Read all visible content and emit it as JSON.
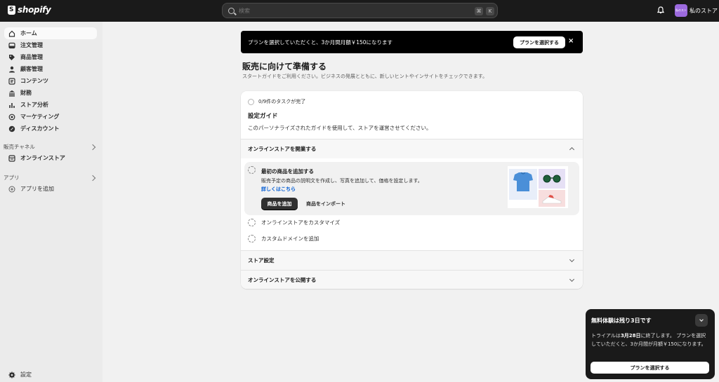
{
  "topbar": {
    "brand": "shopify",
    "search_placeholder": "検索",
    "shortcut_keys": [
      "⌘",
      "K"
    ],
    "store_avatar_text": "私のスト",
    "store_name": "私のストア"
  },
  "sidebar": {
    "items": [
      {
        "label": "ホーム",
        "icon": "home-icon",
        "active": true
      },
      {
        "label": "注文管理",
        "icon": "inbox-icon"
      },
      {
        "label": "商品管理",
        "icon": "tag-icon"
      },
      {
        "label": "顧客管理",
        "icon": "person-icon"
      },
      {
        "label": "コンテンツ",
        "icon": "content-icon"
      },
      {
        "label": "財務",
        "icon": "bank-icon"
      },
      {
        "label": "ストア分析",
        "icon": "bar-chart-icon"
      },
      {
        "label": "マーケティング",
        "icon": "target-icon"
      },
      {
        "label": "ディスカウント",
        "icon": "discount-icon"
      }
    ],
    "sales_channels_label": "販売チャネル",
    "online_store_label": "オンラインストア",
    "apps_label": "アプリ",
    "add_app_label": "アプリを追加",
    "settings_label": "設定"
  },
  "banner": {
    "text": "プランを選択していただくと、3か月間月額￥150になります",
    "button": "プランを選択する",
    "close": "×"
  },
  "main": {
    "title": "販売に向けて準備する",
    "subtitle": "スタートガイドをご利用ください。ビジネスの発展とともに、新しいヒントやインサイトをチェックできます。"
  },
  "setup_guide": {
    "progress": "0/9件のタスクが完了",
    "title": "設定ガイド",
    "description": "このパーソナライズされたガイドを使用して、ストアを運営させてください。",
    "sections": [
      {
        "label": "オンラインストアを開業する",
        "expanded": true
      },
      {
        "label": "ストア設定",
        "expanded": false
      },
      {
        "label": "オンラインストアを公開する",
        "expanded": false
      }
    ],
    "active_task": {
      "title": "最初の商品を追加する",
      "description": "販売予定の商品の説明文を作成し、写真を追加して、価格を設定します。",
      "link": "詳しくはこちら",
      "primary_button": "商品を追加",
      "secondary_button": "商品をインポート"
    },
    "tasks": [
      "オンラインストアをカスタマイズ",
      "カスタムドメインを追加"
    ]
  },
  "toast": {
    "title": "無料体験は残り3日です",
    "body_prefix": "トライアルは",
    "body_date": "3月28日",
    "body_suffix": "に終了します。 プランを選択していただくと、3か月間が月額￥150になります。",
    "button": "プランを選択する"
  }
}
